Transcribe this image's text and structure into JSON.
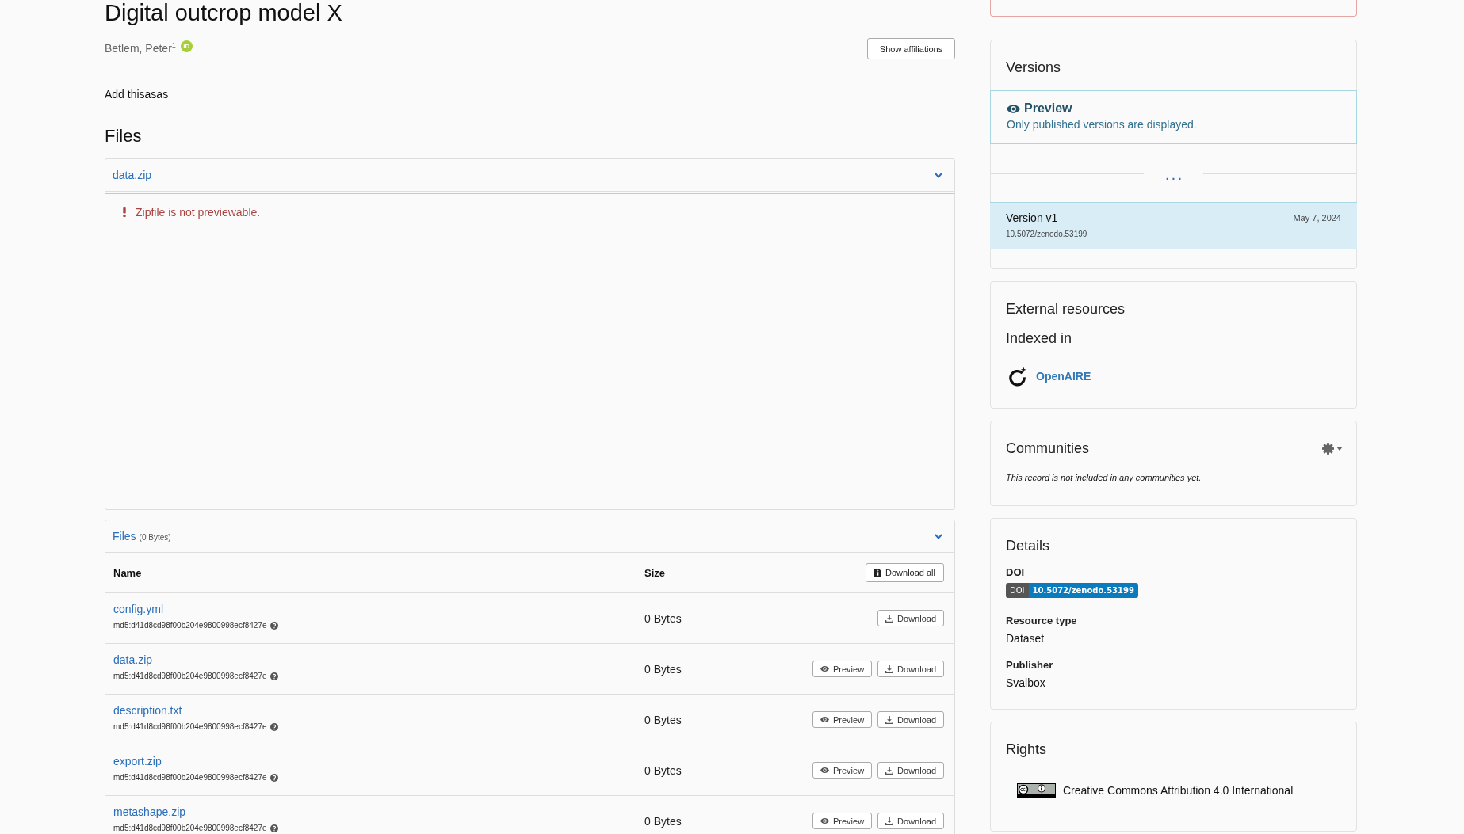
{
  "record": {
    "title": "Digital outcrop model X",
    "creators": [
      {
        "name": "Betlem, Peter$^{1}$",
        "orcid_badge": "iD"
      }
    ],
    "affiliations_button": "Show affiliations",
    "description": "Add thisasas"
  },
  "files": {
    "heading": "Files",
    "preview_panel": {
      "filename": "data.zip",
      "expanded": true,
      "alert": "Zipfile is not previewable."
    },
    "files_panel": {
      "title": "Files",
      "total_size": "(0 Bytes)",
      "expanded": true,
      "columns": [
        "Name",
        "Size"
      ],
      "download_all": "Download all",
      "rows": [
        {
          "name": "config.yml",
          "checksum": "md5:d41d8cd98f00b204e9800998ecf8427e",
          "size": "0 Bytes",
          "actions": [
            {
              "kind": "download",
              "label": "Download"
            }
          ]
        },
        {
          "name": "data.zip",
          "checksum": "md5:d41d8cd98f00b204e9800998ecf8427e",
          "size": "0 Bytes",
          "actions": [
            {
              "kind": "preview",
              "label": "Preview"
            },
            {
              "kind": "download",
              "label": "Download"
            }
          ]
        },
        {
          "name": "description.txt",
          "checksum": "md5:d41d8cd98f00b204e9800998ecf8427e",
          "size": "0 Bytes",
          "actions": [
            {
              "kind": "preview",
              "label": "Preview"
            },
            {
              "kind": "download",
              "label": "Download"
            }
          ]
        },
        {
          "name": "export.zip",
          "checksum": "md5:d41d8cd98f00b204e9800998ecf8427e",
          "size": "0 Bytes",
          "actions": [
            {
              "kind": "preview",
              "label": "Preview"
            },
            {
              "kind": "download",
              "label": "Download"
            }
          ]
        },
        {
          "name": "metashape.zip",
          "checksum": "md5:d41d8cd98f00b204e9800998ecf8427e",
          "size": "0 Bytes",
          "actions": [
            {
              "kind": "preview",
              "label": "Preview"
            },
            {
              "kind": "download",
              "label": "Download"
            }
          ]
        }
      ]
    }
  },
  "versions": {
    "heading": "Versions",
    "preview_notice": {
      "title": "Preview",
      "text": "Only published versions are displayed."
    },
    "more": "...",
    "items": [
      {
        "label": "Version v1",
        "date": "May 7, 2024",
        "doi": "10.5072/zenodo.53199",
        "selected": true
      }
    ]
  },
  "external_resources": {
    "heading": "External resources",
    "subheading": "Indexed in",
    "links": [
      {
        "label": "OpenAIRE"
      }
    ]
  },
  "communities": {
    "heading": "Communities",
    "empty_text": "This record is not included in any communities yet."
  },
  "details": {
    "heading": "Details",
    "fields": [
      {
        "kind": "doi",
        "label": "DOI",
        "badge_label": "DOI",
        "value": "10.5072/zenodo.53199"
      },
      {
        "kind": "text",
        "label": "Resource type",
        "value": "Dataset"
      },
      {
        "kind": "text",
        "label": "Publisher",
        "value": "Svalbox"
      }
    ]
  },
  "rights": {
    "heading": "Rights",
    "licenses": [
      {
        "label": "Creative Commons Attribution 4.0 International"
      }
    ]
  }
}
